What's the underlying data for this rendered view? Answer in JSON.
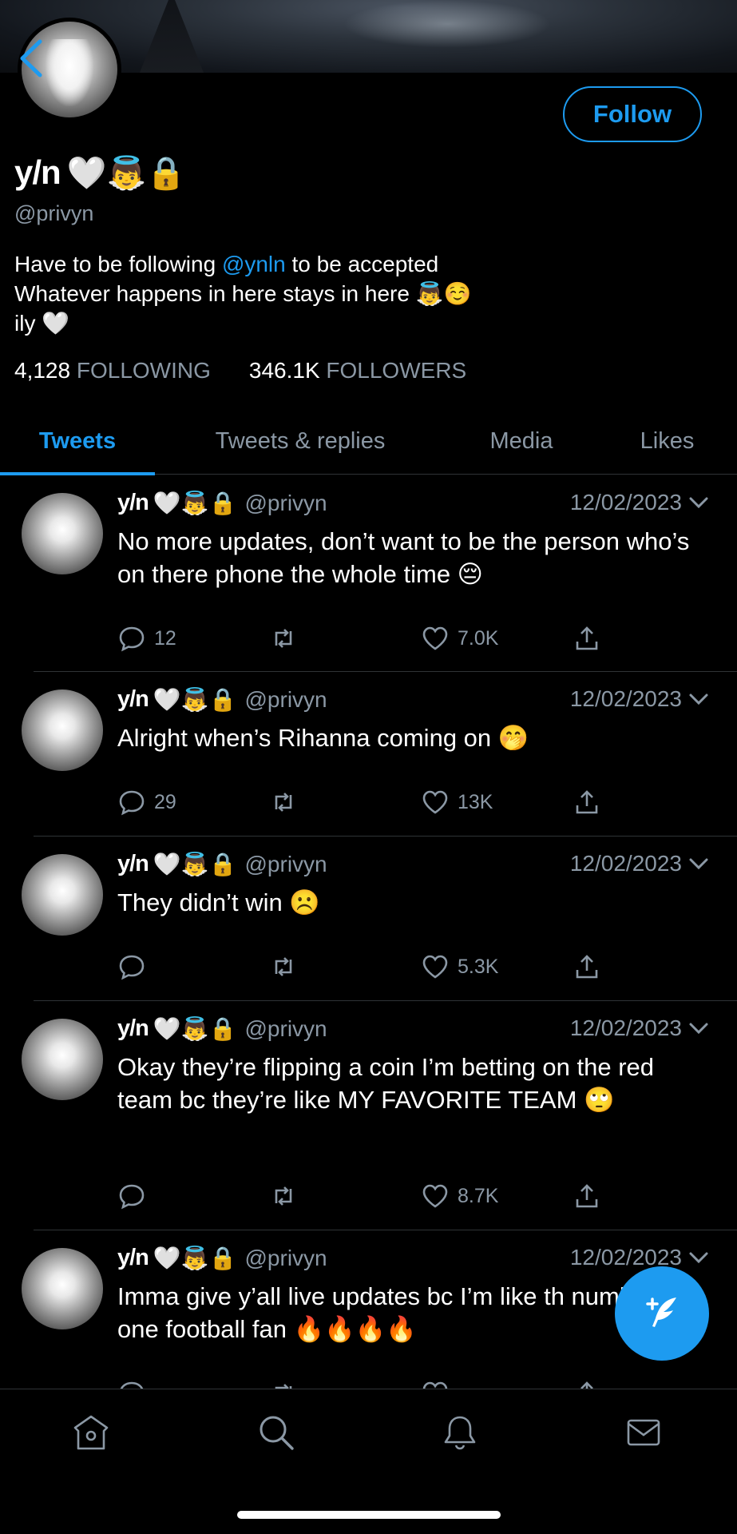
{
  "profile": {
    "display_name": "y/n",
    "name_emojis": "🤍👼🔒",
    "handle": "@privyn",
    "follow_label": "Follow",
    "bio_line1_prefix": "Have to be following ",
    "bio_line1_link": "@ynln",
    "bio_line1_suffix": " to be accepted",
    "bio_line2": "Whatever happens in here stays in here 👼☺️",
    "bio_line3": "ily 🤍",
    "following_count": "4,128",
    "following_label": "FOLLOWING",
    "followers_count": "346.1K",
    "followers_label": "FOLLOWERS"
  },
  "tabs": [
    {
      "label": "Tweets"
    },
    {
      "label": "Tweets & replies"
    },
    {
      "label": "Media"
    },
    {
      "label": "Likes"
    }
  ],
  "tweets": [
    {
      "name": "y/n",
      "emojis": "🤍👼🔒",
      "handle": "@privyn",
      "date": "12/02/2023",
      "text": "No more updates, don’t want to be the person who’s on there phone the whole time 😔",
      "replies": "12",
      "retweets": "",
      "likes": "7.0K"
    },
    {
      "name": "y/n",
      "emojis": "🤍👼🔒",
      "handle": "@privyn",
      "date": "12/02/2023",
      "text": "Alright when’s Rihanna coming on 🤭",
      "replies": "29",
      "retweets": "",
      "likes": "13K"
    },
    {
      "name": "y/n",
      "emojis": "🤍👼🔒",
      "handle": "@privyn",
      "date": "12/02/2023",
      "text": "They didn’t win ☹️",
      "replies": "",
      "retweets": "",
      "likes": "5.3K"
    },
    {
      "name": "y/n",
      "emojis": "🤍👼🔒",
      "handle": "@privyn",
      "date": "12/02/2023",
      "text": "Okay they’re flipping a coin I’m betting on the red team bc they’re like MY FAVORITE TEAM 🙄",
      "replies": "",
      "retweets": "",
      "likes": "8.7K"
    },
    {
      "name": "y/n",
      "emojis": "🤍👼🔒",
      "handle": "@privyn",
      "date": "12/02/2023",
      "text": "Imma give y’all live updates bc I’m like th number one football fan 🔥🔥🔥🔥",
      "replies": "",
      "retweets": "",
      "likes": ""
    }
  ],
  "colors": {
    "accent": "#1d9bf0",
    "muted": "#8b98a5",
    "background": "#000000"
  },
  "icons": [
    "back-arrow-icon",
    "reply-icon",
    "retweet-icon",
    "like-icon",
    "share-icon",
    "chevron-down-icon",
    "compose-icon",
    "home-icon",
    "search-icon",
    "notifications-icon",
    "messages-icon"
  ]
}
